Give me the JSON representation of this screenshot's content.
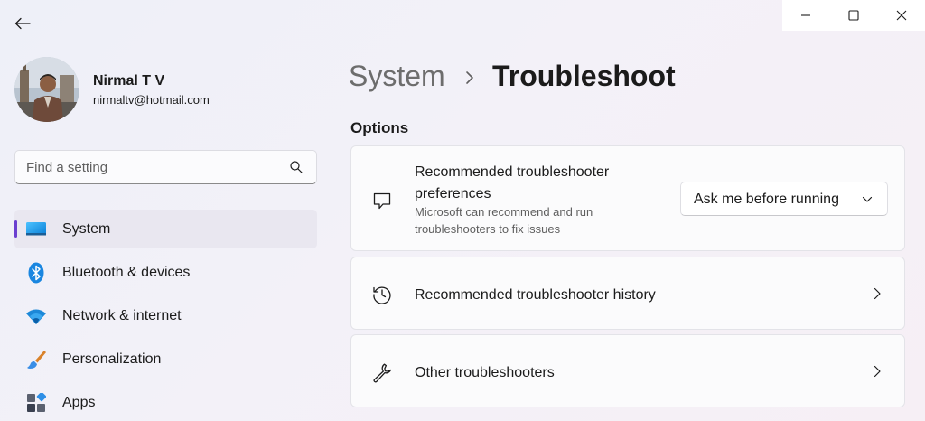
{
  "window": {
    "back_icon": "arrow-left-icon",
    "controls": [
      "minimize-icon",
      "maximize-icon",
      "close-icon"
    ]
  },
  "profile": {
    "name": "Nirmal T V",
    "email": "nirmaltv@hotmail.com"
  },
  "search": {
    "placeholder": "Find a setting",
    "value": ""
  },
  "sidebar": {
    "items": [
      {
        "label": "System",
        "icon": "monitor-icon",
        "selected": true
      },
      {
        "label": "Bluetooth & devices",
        "icon": "bluetooth-icon",
        "selected": false
      },
      {
        "label": "Network & internet",
        "icon": "wifi-icon",
        "selected": false
      },
      {
        "label": "Personalization",
        "icon": "paintbrush-icon",
        "selected": false
      },
      {
        "label": "Apps",
        "icon": "apps-icon",
        "selected": false
      }
    ],
    "accent_color": "#6b3fd0"
  },
  "header": {
    "parent": "System",
    "current": "Troubleshoot"
  },
  "main": {
    "section_title": "Options",
    "cards": [
      {
        "title_line1": "Recommended troubleshooter",
        "title_line2": "preferences",
        "desc_line1": "Microsoft can recommend and run",
        "desc_line2": "troubleshooters to fix issues",
        "icon": "chat-bubble-icon",
        "dropdown_value": "Ask me before running"
      },
      {
        "title": "Recommended troubleshooter history",
        "icon": "history-icon"
      },
      {
        "title": "Other troubleshooters",
        "icon": "wrench-icon"
      }
    ]
  }
}
